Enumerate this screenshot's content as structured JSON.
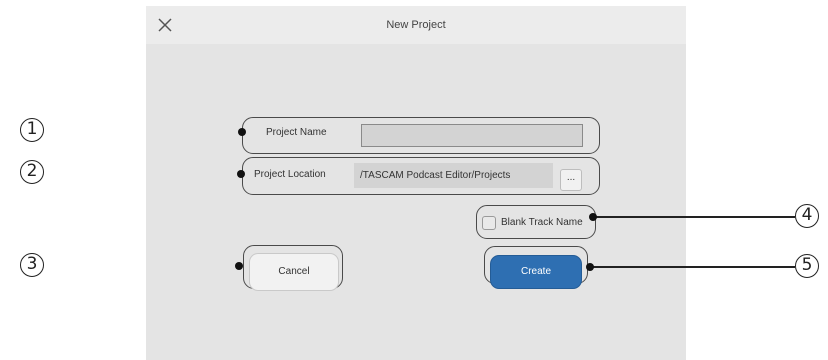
{
  "dialog": {
    "title": "New Project",
    "close_icon": "close-icon"
  },
  "project_name": {
    "label": "Project Name",
    "value": ""
  },
  "project_location": {
    "label": "Project Location",
    "path": "/TASCAM Podcast Editor/Projects",
    "browse_label": "..."
  },
  "blank_track_name": {
    "label": "Blank Track Name",
    "checked": false
  },
  "buttons": {
    "cancel": "Cancel",
    "create": "Create"
  },
  "callouts": [
    "1",
    "2",
    "3",
    "4",
    "5"
  ],
  "colors": {
    "dialog_bg": "#e4e4e4",
    "titlebar_bg": "#ececec",
    "create_button": "#2e6fb2"
  }
}
